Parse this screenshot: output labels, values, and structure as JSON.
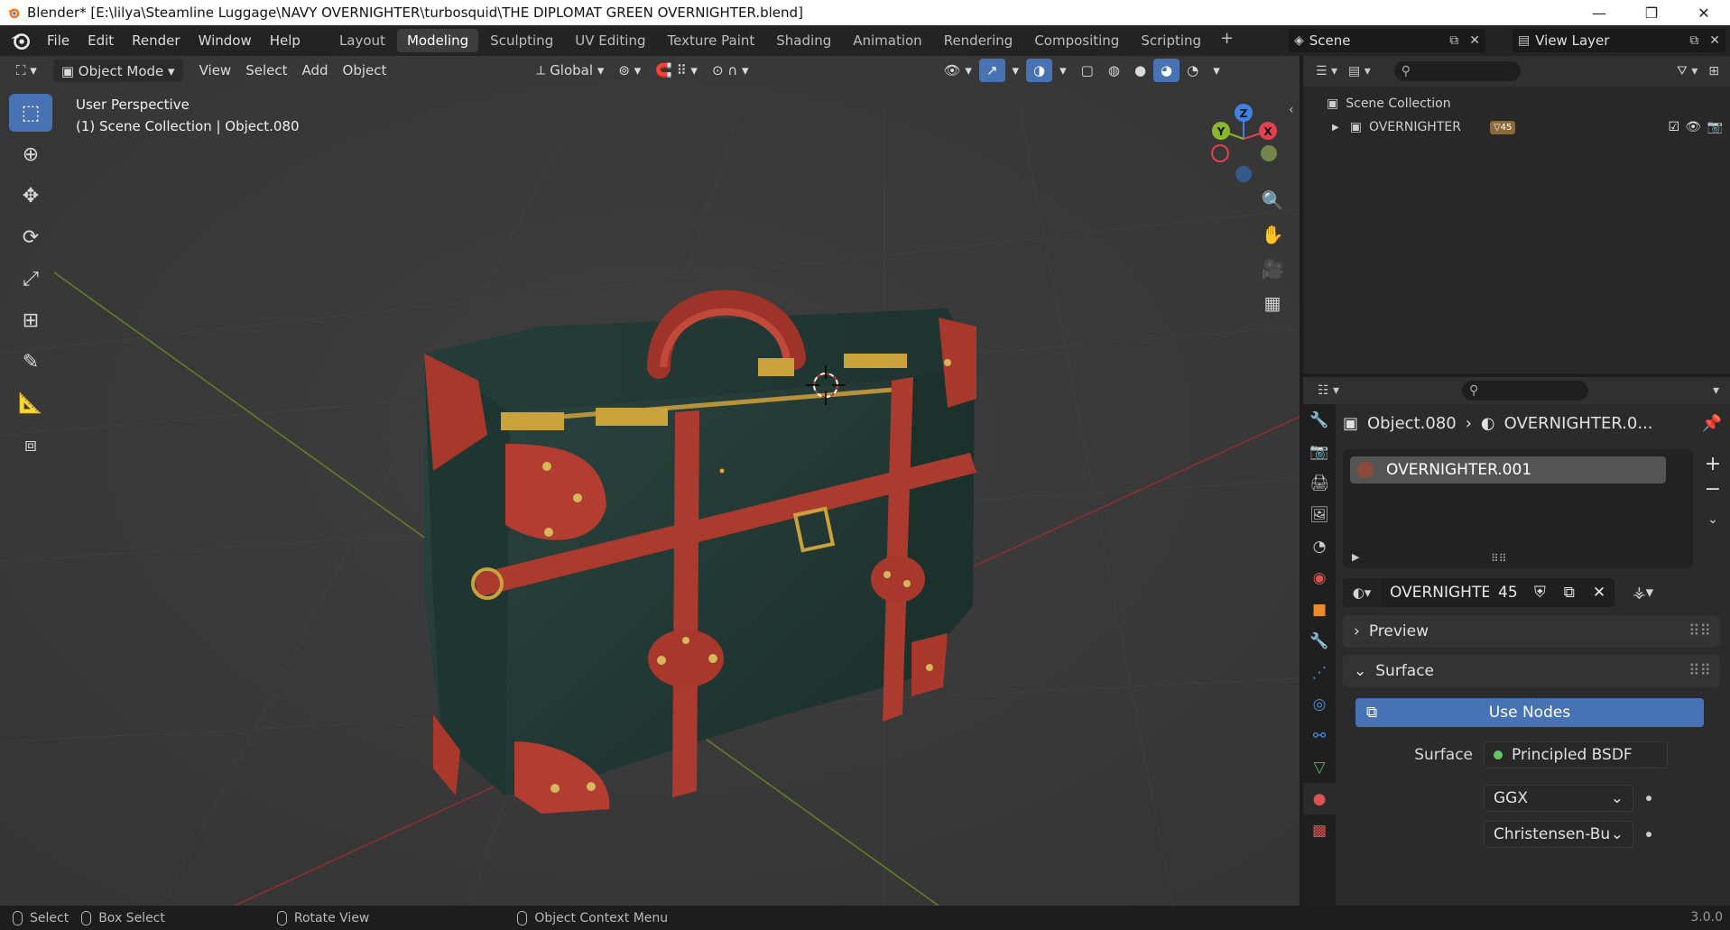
{
  "window": {
    "title": "Blender* [E:\\lilya\\Steamline Luggage\\NAVY OVERNIGHTER\\turbosquid\\THE DIPLOMAT GREEN OVERNIGHTER.blend]",
    "minimize": "—",
    "maximize": "❐",
    "close": "✕"
  },
  "menu": [
    "File",
    "Edit",
    "Render",
    "Window",
    "Help"
  ],
  "workspaces": [
    {
      "label": "Layout",
      "active": false
    },
    {
      "label": "Modeling",
      "active": true
    },
    {
      "label": "Sculpting",
      "active": false
    },
    {
      "label": "UV Editing",
      "active": false
    },
    {
      "label": "Texture Paint",
      "active": false
    },
    {
      "label": "Shading",
      "active": false
    },
    {
      "label": "Animation",
      "active": false
    },
    {
      "label": "Rendering",
      "active": false
    },
    {
      "label": "Compositing",
      "active": false
    },
    {
      "label": "Scripting",
      "active": false
    }
  ],
  "add_workspace": "+",
  "scene": {
    "name": "Scene"
  },
  "view_layer": {
    "name": "View Layer"
  },
  "viewport": {
    "mode": "Object Mode",
    "menus": [
      "View",
      "Select",
      "Add",
      "Object"
    ],
    "orientation": "Global",
    "info_line1": "User Perspective",
    "info_line2": "(1) Scene Collection | Object.080",
    "axes": {
      "x": "X",
      "y": "Y",
      "z": "Z"
    }
  },
  "outliner": {
    "root": "Scene Collection",
    "items": [
      {
        "label": "OVERNIGHTER",
        "badge": "45"
      }
    ]
  },
  "properties": {
    "object_name": "Object.080",
    "material_short": "OVERNIGHTER.0...",
    "slot_name": "OVERNIGHTER.001",
    "material_field": "OVERNIGHTE...",
    "user_count": "45",
    "panels": {
      "preview": "Preview",
      "surface": "Surface"
    },
    "use_nodes": "Use Nodes",
    "surface_label": "Surface",
    "surface_value": "Principled BSDF",
    "distribution": "GGX",
    "subsurface": "Christensen-Burley"
  },
  "statusbar": {
    "select": "Select",
    "box_select": "Box Select",
    "rotate": "Rotate View",
    "context_menu": "Object Context Menu",
    "version": "3.0.0"
  },
  "colors": {
    "accent": "#4772b3",
    "suitcase_body": "#223a35",
    "leather": "#b03a2e",
    "brass": "#c9a23a",
    "axis_x": "#e0424f",
    "axis_y": "#8ab82d",
    "axis_z": "#3f82e0"
  }
}
